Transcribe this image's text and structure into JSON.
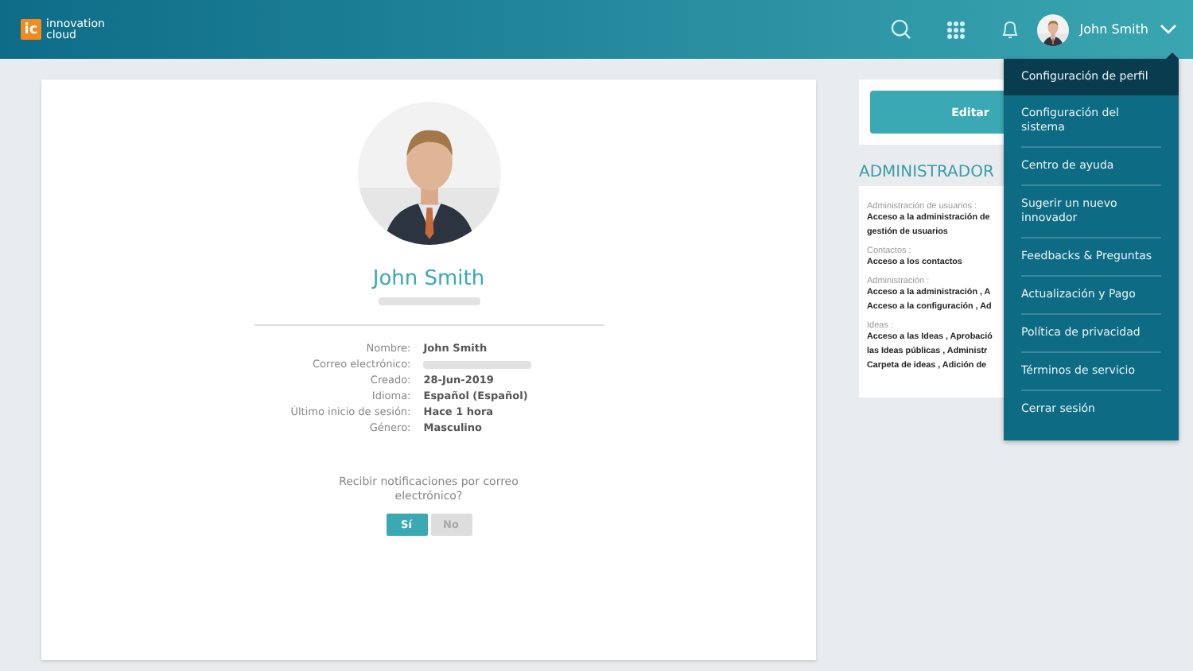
{
  "header": {
    "logo_mark": "ic",
    "logo_text": "innovation cloud",
    "user_name": "John Smith"
  },
  "profile": {
    "name": "John Smith",
    "email_redacted": true,
    "details": [
      {
        "label": "Nombre:",
        "value": "John Smith"
      },
      {
        "label": "Correo electrónico:",
        "redacted": true
      },
      {
        "label": "Creado:",
        "value": "28-Jun-2019"
      },
      {
        "label": "Idioma:",
        "value": "Español (Español)"
      },
      {
        "label": "Último inicio de sesión:",
        "value": "Hace 1 hora"
      },
      {
        "label": "Género:",
        "value": "Masculino"
      }
    ],
    "notifications": {
      "question": "Recibir notificaciones por correo electrónico?",
      "options": [
        {
          "label": "Sí",
          "selected": true
        },
        {
          "label": "No",
          "selected": false
        }
      ]
    }
  },
  "sidebar": {
    "edit_button": "Editar",
    "role_title": "ADMINISTRADOR",
    "sections": [
      {
        "title": "Administración de usuarios :",
        "lines": [
          "Acceso a la administración de",
          "gestión de usuarios"
        ]
      },
      {
        "title": "Contactos :",
        "lines": [
          "Acceso a los contactos"
        ]
      },
      {
        "title": "Administración :",
        "lines": [
          "Acceso a la administración , A",
          "Acceso a la configuración , Ad"
        ]
      },
      {
        "title": "Ideas :",
        "lines": [
          "Acceso a las Ideas , Aprobació",
          "las Ideas públicas , Administr",
          "Carpeta de ideas , Adición de"
        ]
      }
    ]
  },
  "user_menu": [
    {
      "label": "Configuración de perfil",
      "selected": true
    },
    {
      "label": "Configuración del sistema",
      "selected": false
    },
    {
      "label": "Centro de ayuda",
      "selected": false
    },
    {
      "label": "Sugerir un nuevo innovador",
      "selected": false
    },
    {
      "label": "Feedbacks & Preguntas",
      "selected": false
    },
    {
      "label": "Actualización y Pago",
      "selected": false
    },
    {
      "label": "Política de privacidad",
      "selected": false
    },
    {
      "label": "Términos de servicio",
      "selected": false
    },
    {
      "label": "Cerrar sesión",
      "selected": false
    }
  ]
}
